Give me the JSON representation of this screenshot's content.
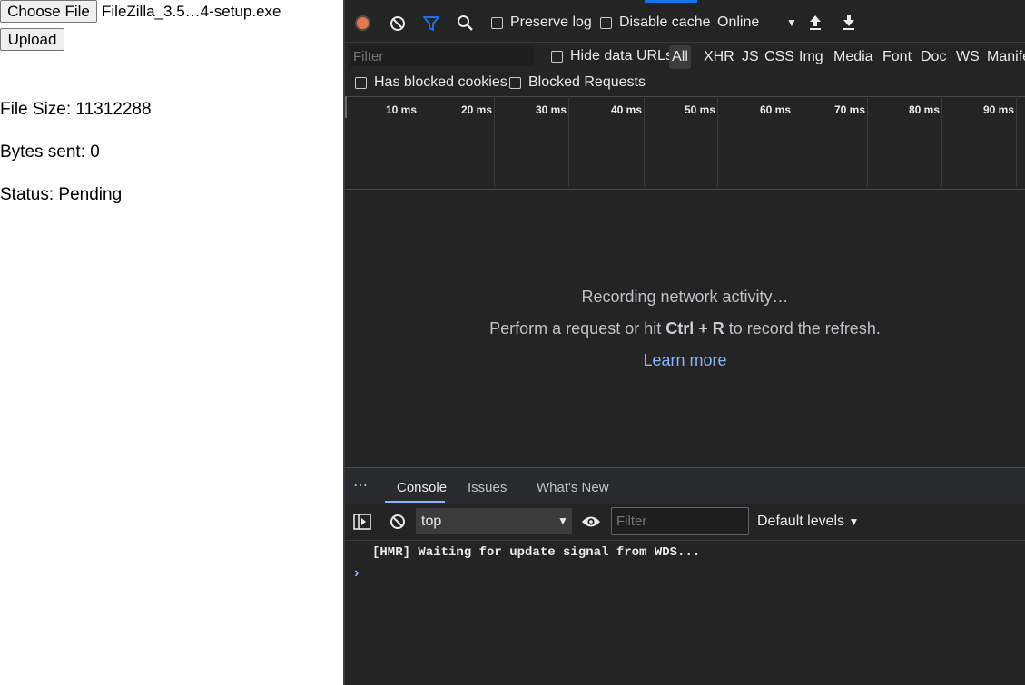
{
  "app": {
    "choose_file_label": "Choose File",
    "file_name": "FileZilla_3.5…4-setup.exe",
    "upload_label": "Upload",
    "file_size_text": "File Size: 11312288",
    "bytes_sent_text": "Bytes sent: 0",
    "status_text": "Status: Pending"
  },
  "network": {
    "preserve_log_label": "Preserve log",
    "disable_cache_label": "Disable cache",
    "throttling_value": "Online",
    "filter_placeholder": "Filter",
    "hide_data_urls_label": "Hide data URLs",
    "type_filters": [
      "All",
      "XHR",
      "JS",
      "CSS",
      "Img",
      "Media",
      "Font",
      "Doc",
      "WS",
      "Manifest"
    ],
    "has_blocked_cookies_label": "Has blocked cookies",
    "blocked_requests_label": "Blocked Requests",
    "timeline_ticks": [
      "10 ms",
      "20 ms",
      "30 ms",
      "40 ms",
      "50 ms",
      "60 ms",
      "70 ms",
      "80 ms",
      "90 ms"
    ],
    "empty_title": "Recording network activity…",
    "empty_hint_prefix": "Perform a request or hit ",
    "empty_hint_keys": "Ctrl + R",
    "empty_hint_suffix": " to record the refresh.",
    "learn_more": "Learn more"
  },
  "drawer": {
    "tabs": [
      "Console",
      "Issues",
      "What's New"
    ],
    "active_tab": "Console",
    "context_value": "top",
    "filter_placeholder": "Filter",
    "levels_label": "Default levels",
    "messages": [
      "[HMR] Waiting for update signal from WDS..."
    ]
  },
  "colors": {
    "record": "#e07a4e",
    "accent": "#8ab4f8",
    "devtools_bg": "#242424"
  },
  "icons": [
    "record-icon",
    "clear-icon",
    "filter-icon",
    "search-icon",
    "import-icon",
    "export-icon",
    "sidebar-toggle-icon",
    "eye-icon"
  ]
}
